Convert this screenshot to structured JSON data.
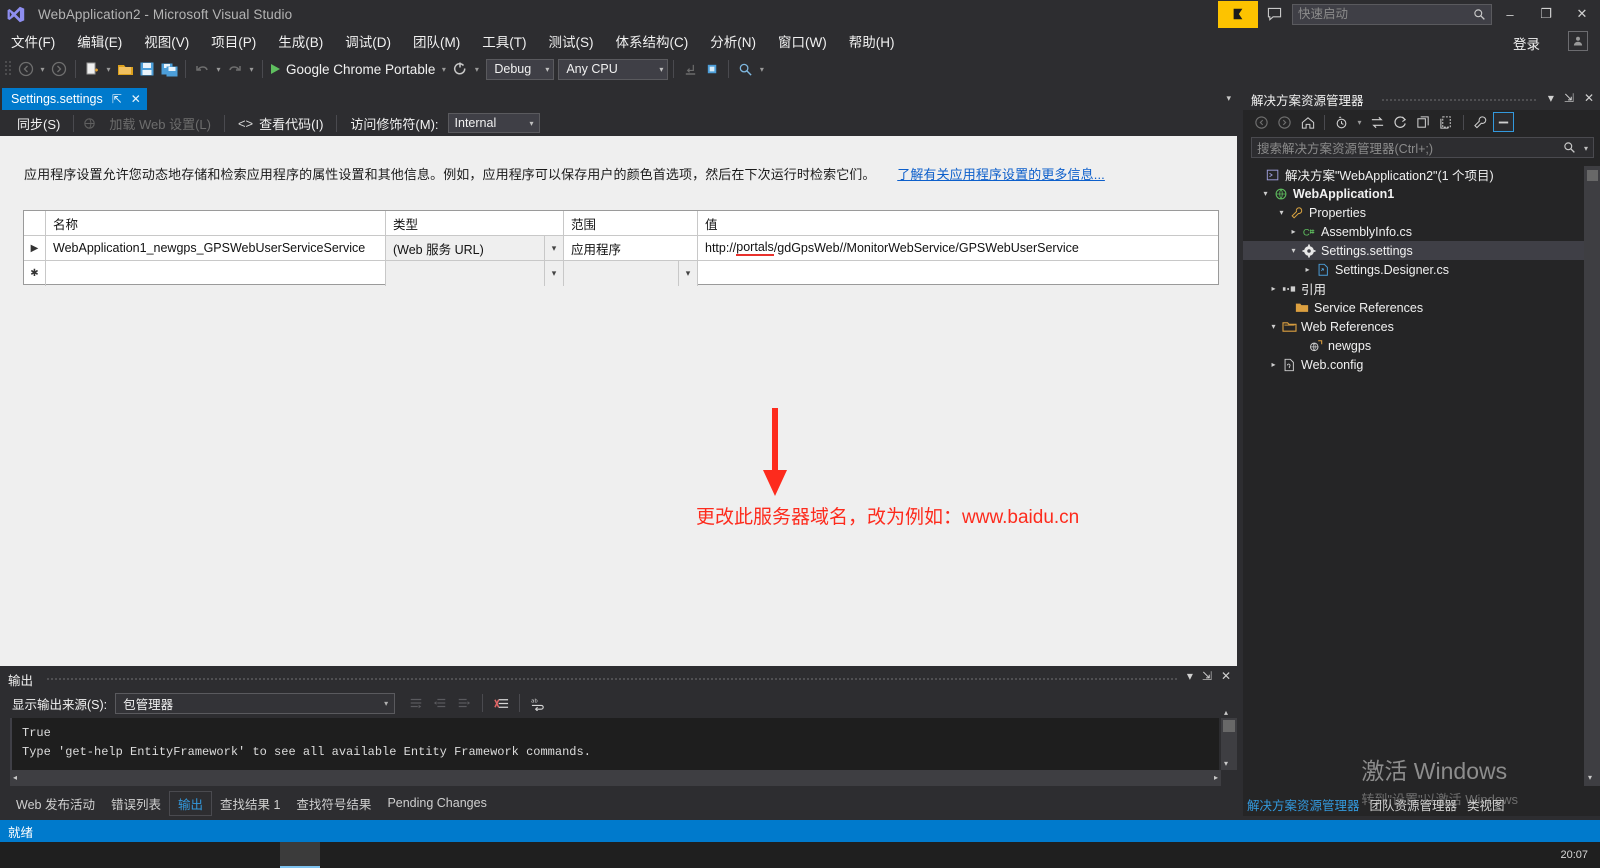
{
  "titlebar": {
    "app_title": "WebApplication2 - Microsoft Visual Studio",
    "quick_launch_placeholder": "快速启动",
    "signin_label": "登录",
    "logo_icon": "visual-studio-logo",
    "feedback_icon": "feedback-flag-icon",
    "speech_icon": "speech-bubble-icon",
    "search_icon": "search-icon",
    "minimize_label": "–",
    "maximize_label": "❐",
    "close_label": "✕"
  },
  "menubar": {
    "items": [
      {
        "label": "文件(F)"
      },
      {
        "label": "编辑(E)"
      },
      {
        "label": "视图(V)"
      },
      {
        "label": "项目(P)"
      },
      {
        "label": "生成(B)"
      },
      {
        "label": "调试(D)"
      },
      {
        "label": "团队(M)"
      },
      {
        "label": "工具(T)"
      },
      {
        "label": "测试(S)"
      },
      {
        "label": "体系结构(C)"
      },
      {
        "label": "分析(N)"
      },
      {
        "label": "窗口(W)"
      },
      {
        "label": "帮助(H)"
      }
    ]
  },
  "toolbar": {
    "nav_back_icon": "navigate-back-icon",
    "nav_forward_icon": "navigate-forward-icon",
    "new_item_icon": "new-item-icon",
    "open_file_icon": "open-file-icon",
    "save_icon": "save-icon",
    "save_all_icon": "save-all-icon",
    "undo_icon": "undo-icon",
    "redo_icon": "redo-icon",
    "run_label": "Google Chrome Portable",
    "refresh_icon": "refresh-icon",
    "configuration": "Debug",
    "platform": "Any CPU",
    "step_icon": "step-into-icon",
    "attach_icon": "attach-process-icon",
    "find_icon": "find-icon"
  },
  "document_tab": {
    "label": "Settings.settings",
    "pin_icon": "pin-icon",
    "close_icon": "close-icon",
    "tabstrip_caret_icon": "chevron-down-icon"
  },
  "editor_toolbar": {
    "sync_label": "同步(S)",
    "load_web_settings_label": "加载 Web 设置(L)",
    "view_code_label": "查看代码(I)",
    "view_code_icon": "code-brackets-icon",
    "access_modifier_label": "访问修饰符(M):",
    "access_modifier_value": "Internal"
  },
  "editor": {
    "description": "应用程序设置允许您动态地存储和检索应用程序的属性设置和其他信息。例如，应用程序可以保存用户的颜色首选项，然后在下次运行时检索它们。",
    "description_link": "了解有关应用程序设置的更多信息...",
    "grid": {
      "columns": [
        "名称",
        "类型",
        "范围",
        "值"
      ],
      "rows": [
        {
          "selector": "▶",
          "name": "WebApplication1_newgps_GPSWebUserServiceService",
          "type": "(Web 服务 URL)",
          "scope": "应用程序",
          "value_prefix": "http://",
          "value_underlined": "portals",
          "value_suffix": "/gdGpsWeb//MonitorWebService/GPSWebUserService"
        },
        {
          "selector": "✱",
          "name": "",
          "type": "",
          "scope": "",
          "value_prefix": "",
          "value_underlined": "",
          "value_suffix": ""
        }
      ]
    },
    "annotation": {
      "arrow_icon": "down-arrow-annotation",
      "text": "更改此服务器域名，改为例如：www.baidu.cn",
      "color": "#fd2b1d"
    }
  },
  "output_panel": {
    "title": "输出",
    "source_label": "显示输出来源(S):",
    "source_value": "包管理器",
    "lines": [
      "True",
      "",
      "Type 'get-help EntityFramework' to see all available Entity Framework commands."
    ],
    "clear_icon": "clear-all-icon",
    "wrap_icon": "word-wrap-icon",
    "goto_icon": "goto-message-icon",
    "prev_icon": "previous-message-icon",
    "next_icon": "next-message-icon",
    "minimize_icon": "minimize-icon",
    "pin_icon": "pin-icon",
    "close_icon": "close-icon"
  },
  "bottom_tabs": {
    "items": [
      {
        "label": "Web 发布活动",
        "active": false
      },
      {
        "label": "错误列表",
        "active": false
      },
      {
        "label": "输出",
        "active": true
      },
      {
        "label": "查找结果 1",
        "active": false
      },
      {
        "label": "查找符号结果",
        "active": false
      },
      {
        "label": "Pending Changes",
        "active": false
      }
    ]
  },
  "solution_explorer": {
    "title": "解决方案资源管理器",
    "search_placeholder": "搜索解决方案资源管理器(Ctrl+;)",
    "toolbar": {
      "back_icon": "navigate-back-icon",
      "forward_icon": "navigate-forward-icon",
      "home_icon": "home-icon",
      "pending_changes_icon": "pending-changes-icon",
      "sync_icon": "sync-with-active-document-icon",
      "refresh_icon": "refresh-icon",
      "collapse_icon": "collapse-all-icon",
      "show_all_files_icon": "show-all-files-icon",
      "properties_icon": "properties-wrench-icon",
      "preview_icon": "preview-selected-items-icon"
    },
    "header_icons": {
      "dropdown_icon": "chevron-down-icon",
      "pin_icon": "pin-icon",
      "close_icon": "close-icon"
    },
    "tree": [
      {
        "label": "解决方案\"WebApplication2\"(1 个项目)",
        "indent": 0,
        "expander": "",
        "icon": "solution-icon",
        "bold": false,
        "selected": false
      },
      {
        "label": "WebApplication1",
        "indent": 1,
        "expander": "▾",
        "icon": "web-project-icon",
        "bold": true,
        "selected": false
      },
      {
        "label": "Properties",
        "indent": 2,
        "expander": "▾",
        "icon": "wrench-icon",
        "bold": false,
        "selected": false
      },
      {
        "label": "AssemblyInfo.cs",
        "indent": 3,
        "expander": "▸",
        "icon": "csharp-file-icon",
        "bold": false,
        "selected": false
      },
      {
        "label": "Settings.settings",
        "indent": 3,
        "expander": "▾",
        "icon": "settings-gear-icon",
        "bold": false,
        "selected": true
      },
      {
        "label": "Settings.Designer.cs",
        "indent": 4,
        "expander": "▸",
        "icon": "designer-file-icon",
        "bold": false,
        "selected": false
      },
      {
        "label": "引用",
        "indent": 2,
        "expander": "▸",
        "icon": "references-icon",
        "bold": false,
        "selected": false
      },
      {
        "label": "Service References",
        "indent": 2,
        "expander": "",
        "icon": "folder-icon",
        "bold": false,
        "selected": false
      },
      {
        "label": "Web References",
        "indent": 2,
        "expander": "▾",
        "icon": "web-folder-icon",
        "bold": false,
        "selected": false
      },
      {
        "label": "newgps",
        "indent": 3,
        "expander": "",
        "icon": "web-reference-icon",
        "bold": false,
        "selected": false
      },
      {
        "label": "Web.config",
        "indent": 2,
        "expander": "▸",
        "icon": "config-file-icon",
        "bold": false,
        "selected": false
      }
    ],
    "bottom_tabs": [
      {
        "label": "解决方案资源管理器",
        "active": true
      },
      {
        "label": "团队资源管理器",
        "active": false
      },
      {
        "label": "类视图",
        "active": false
      }
    ]
  },
  "watermark": {
    "line1": "激活 Windows",
    "line2": "转到\"设置\"以激活 Windows"
  },
  "statusbar": {
    "text": "就绪"
  },
  "taskbar": {
    "clock": "20:07"
  },
  "colors": {
    "accent_blue": "#007acc",
    "annotation_red": "#fd2b1d",
    "titlebar_bg": "#2d2d30",
    "editor_bg": "#efefef",
    "panel_bg": "#252526"
  }
}
